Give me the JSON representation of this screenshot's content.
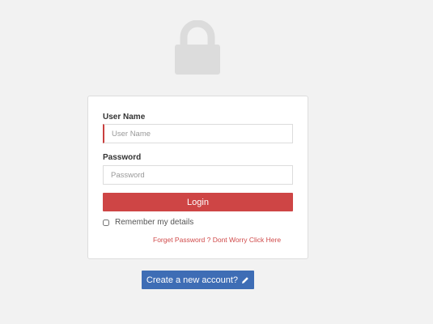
{
  "icons": {
    "lock": "lock-icon",
    "pencil": "pencil-icon"
  },
  "colors": {
    "background": "#f2f2f2",
    "lock": "#dcdcdc",
    "login_button": "#ce4545",
    "forgot_link": "#d04a4a",
    "create_button": "#3e6db5"
  },
  "login_form": {
    "username": {
      "label": "User Name",
      "placeholder": "User Name",
      "value": ""
    },
    "password": {
      "label": "Password",
      "placeholder": "Password",
      "value": ""
    },
    "login_button_label": "Login",
    "remember_me": {
      "label": "Remember my details",
      "checked": false
    },
    "forgot_password_link": "Forget Password ? Dont Worry Click Here"
  },
  "create_account_button_label": "Create a new account?"
}
